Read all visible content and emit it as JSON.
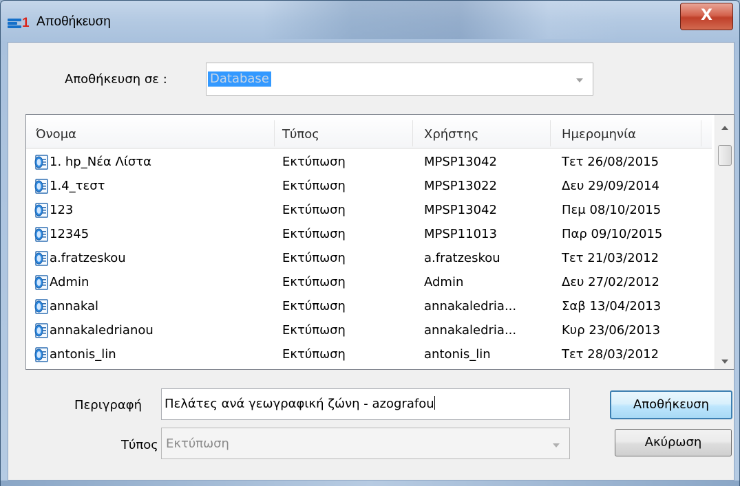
{
  "window": {
    "title": "Αποθήκευση",
    "app_logo_text": "1",
    "close_label": "X"
  },
  "save_in": {
    "label": "Αποθήκευση σε :",
    "value": "Database"
  },
  "list": {
    "columns": [
      "Όνομα",
      "Τύπος",
      "Χρήστης",
      "Ημερομηνία"
    ],
    "rows": [
      {
        "name": "1. hp_Νέα Λίστα",
        "type": "Εκτύπωση",
        "user": "MPSP13042",
        "date": "Τετ 26/08/2015"
      },
      {
        "name": "1.4_τεστ",
        "type": "Εκτύπωση",
        "user": "MPSP13022",
        "date": "Δευ 29/09/2014"
      },
      {
        "name": "123",
        "type": "Εκτύπωση",
        "user": "MPSP13042",
        "date": "Πεμ 08/10/2015"
      },
      {
        "name": "12345",
        "type": "Εκτύπωση",
        "user": "MPSP11013",
        "date": "Παρ 09/10/2015"
      },
      {
        "name": "a.fratzeskou",
        "type": "Εκτύπωση",
        "user": "a.fratzeskou",
        "date": "Τετ 21/03/2012"
      },
      {
        "name": "Admin",
        "type": "Εκτύπωση",
        "user": "Admin",
        "date": "Δευ 27/02/2012"
      },
      {
        "name": "annakal",
        "type": "Εκτύπωση",
        "user": "annakaledria...",
        "date": "Σαβ 13/04/2013"
      },
      {
        "name": "annakaledrianou",
        "type": "Εκτύπωση",
        "user": "annakaledria...",
        "date": "Κυρ 23/06/2013"
      },
      {
        "name": "antonis_lin",
        "type": "Εκτύπωση",
        "user": "antonis_lin",
        "date": "Τετ 28/03/2012"
      }
    ],
    "row_icon": "report-file-icon"
  },
  "form": {
    "description_label": "Περιγραφή",
    "description_value": "Πελάτες ανά γεωγραφική ζώνη - azografou",
    "type_label": "Τύπος",
    "type_value": "Εκτύπωση"
  },
  "buttons": {
    "save": "Αποθήκευση",
    "cancel": "Ακύρωση"
  },
  "colors": {
    "selection": "#3399ff",
    "close_button": "#c9452f",
    "logo_blue": "#1670c9",
    "logo_red": "#d9261c"
  }
}
